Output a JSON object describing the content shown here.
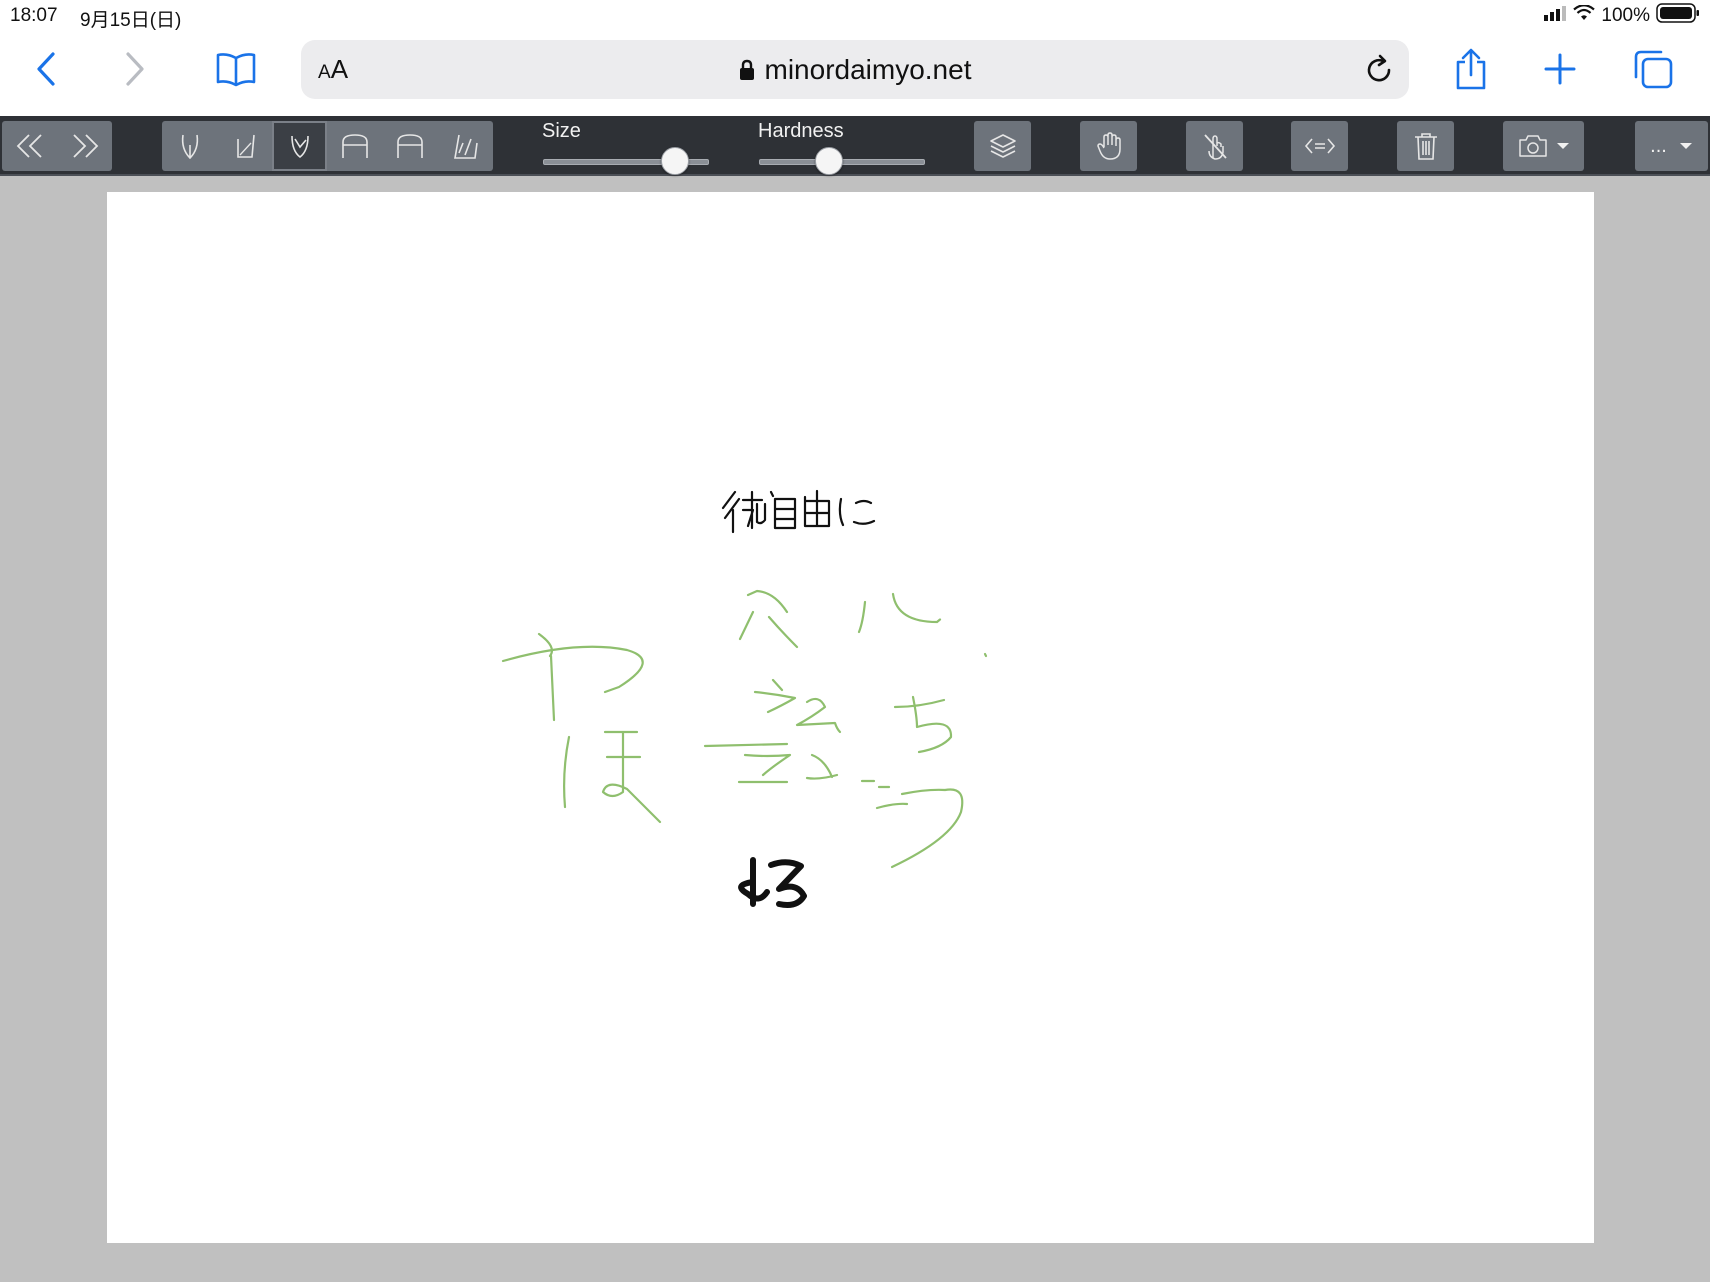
{
  "status_bar": {
    "time": "18:07",
    "date": "9月15日(日)",
    "battery": "100%"
  },
  "browser": {
    "text_size_label": "AA",
    "host": "minordaimyo.net",
    "back_icon": "chevron-left-icon",
    "forward_icon": "chevron-right-icon",
    "bookmarks_icon": "book-icon",
    "reload_icon": "reload-icon",
    "share_icon": "share-icon",
    "new_tab_icon": "plus-icon",
    "tabs_icon": "tabs-icon",
    "accent_color": "#1a73e8"
  },
  "app_toolbar": {
    "history_tools": [
      "undo-icon",
      "redo-icon"
    ],
    "brush_tools": [
      "pen-icon",
      "marker-icon",
      "brush-icon",
      "wide-brush-icon",
      "flat-brush-icon",
      "eraser-icon"
    ],
    "active_brush_index": 2,
    "size_label": "Size",
    "size_value": 0.8,
    "hardness_label": "Hardness",
    "hardness_value": 0.42,
    "layers_icon": "layers-icon",
    "hand_icon": "hand-icon",
    "no_touch_icon": "no-touch-icon",
    "flip_icon": "flip-icon",
    "trash_icon": "trash-icon",
    "camera_icon": "camera-icon",
    "more_label": "...",
    "bg_color": "#2e3136"
  },
  "canvas": {
    "background": "#ffffff",
    "ink_black": "#111111",
    "ink_green": "#8fbf6e"
  }
}
